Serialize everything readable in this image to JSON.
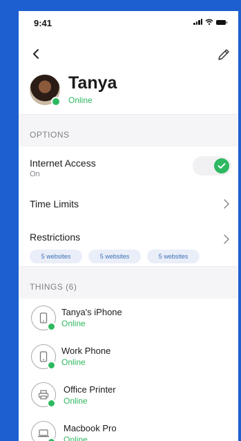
{
  "status_bar": {
    "time": "9:41"
  },
  "profile": {
    "name": "Tanya",
    "status": "Online"
  },
  "sections": {
    "options": {
      "title": "OPTIONS"
    },
    "things": {
      "title": "THINGS (6)"
    }
  },
  "options": {
    "internet_access": {
      "label": "Internet Access",
      "value": "On",
      "enabled": true
    },
    "time_limits": {
      "label": "Time Limits"
    },
    "restrictions": {
      "label": "Restrictions",
      "chips": [
        "5 websites",
        "5 websites",
        "5 websites"
      ]
    }
  },
  "devices": [
    {
      "name": "Tanya's iPhone",
      "status": "Online",
      "icon": "phone-icon"
    },
    {
      "name": "Work Phone",
      "status": "Online",
      "icon": "phone-icon"
    },
    {
      "name": "Office Printer",
      "status": "Online",
      "icon": "printer-icon"
    },
    {
      "name": "Macbook Pro",
      "status": "Online",
      "icon": "laptop-icon"
    }
  ],
  "colors": {
    "accent_green": "#2eb860",
    "frame_blue": "#1d5fd0",
    "chip_text": "#3e6fb6",
    "muted": "#7b7f86"
  }
}
